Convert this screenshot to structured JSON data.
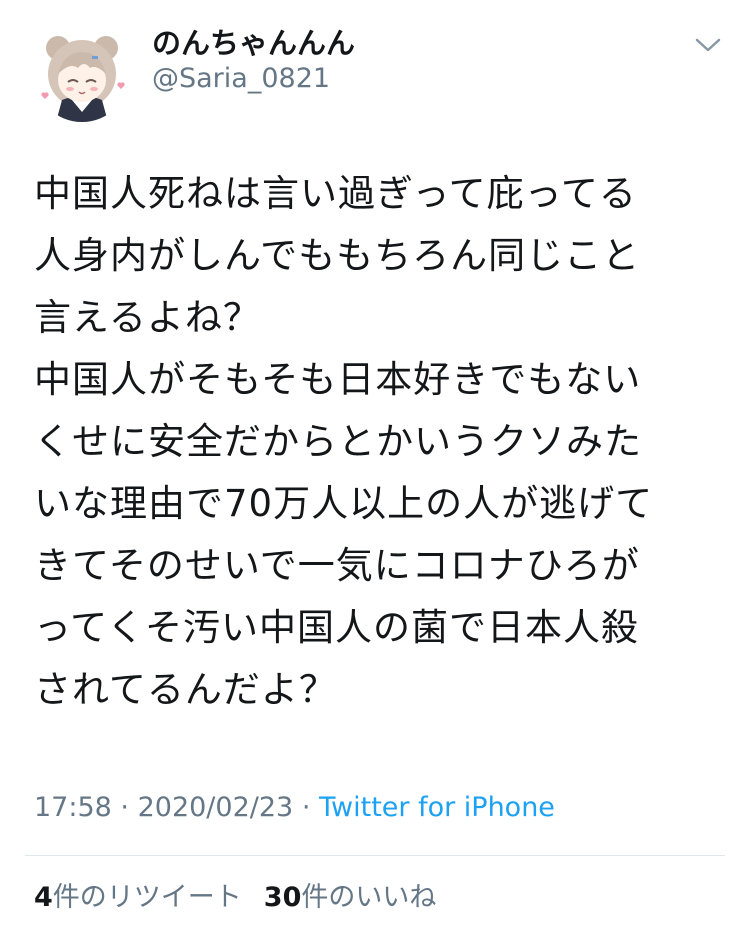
{
  "user": {
    "display_name": "のんちゃんんん",
    "handle": "@Saria_0821",
    "avatar_icon": "anime-girl-avatar",
    "menu_icon": "chevron-down-icon"
  },
  "tweet": {
    "text": "中国人死ねは言い過ぎって庇ってる\n人身内がしんでももちろん同じこと\n言えるよね？\n中国人がそもそも日本好きでもない\nくせに安全だからとかいうクソみた\nいな理由で70万人以上の人が逃げて\nきてそのせいで一気にコロナひろが\nってくそ汚い中国人の菌で日本人殺\nされてるんだよ？",
    "time": "17:58",
    "date": "2020/02/23",
    "separator": "·",
    "source": "Twitter for iPhone"
  },
  "stats": {
    "retweets_count": "4",
    "retweets_label": "件のリツイート",
    "likes_count": "30",
    "likes_label": "件のいいね"
  },
  "colors": {
    "text": "#14171a",
    "secondary": "#657786",
    "link": "#1da1f2",
    "divider": "#e1e8ed"
  }
}
